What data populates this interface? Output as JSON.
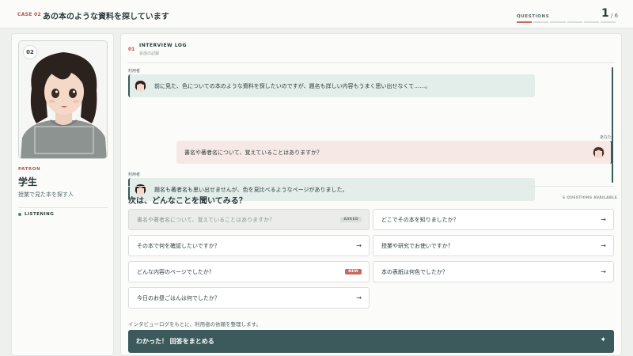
{
  "header": {
    "case_label": "CASE 02",
    "title": "あの本のような資料を探しています",
    "questions_label": "QUESTIONS",
    "current": "1",
    "total": "/ 6",
    "progress_segments": 6,
    "progress_done": 1
  },
  "patron": {
    "number": "02",
    "label": "PATRON",
    "name": "学生",
    "description": "授業で見た本を探す人",
    "status": "LISTENING"
  },
  "log": {
    "number": "01",
    "title": "INTERVIEW LOG",
    "subtitle": "会話の記録",
    "messages": [
      {
        "role": "patron",
        "speaker": "利用者",
        "text": "前に見た、色についての本のような資料を探したいのですが、題名も詳しい内容もうまく思い出せなくて……。"
      },
      {
        "role": "user",
        "speaker": "あなた",
        "text": "書名や著者名について、覚えていることはありますか？"
      },
      {
        "role": "patron",
        "speaker": "利用者",
        "text": "題名も著者名も思い出せませんが、色を見比べるようなページがありました。"
      }
    ]
  },
  "next": {
    "title": "次は、どんなことを聞いてみる？",
    "available": "6 QUESTIONS AVAILABLE",
    "questions": [
      {
        "text": "書名や著者名について、覚えていることはありますか？",
        "badge": "ASKED"
      },
      {
        "text": "どこでその本を知りましたか？",
        "arrow": "→"
      },
      {
        "text": "その本で何を確認したいですか？",
        "arrow": "→"
      },
      {
        "text": "授業や研究でお使いですか？",
        "arrow": "→"
      },
      {
        "text": "どんな内容のページでしたか？",
        "badge": "NEW"
      },
      {
        "text": "本の表紙は何色でしたか？",
        "arrow": "→"
      },
      {
        "text": "今日のお昼ごはんは何でしたか？",
        "arrow": "→"
      }
    ]
  },
  "footer": {
    "note": "インタビューログをもとに、利用者の依頼を整理します。",
    "submit_label": "わかった！ 回答をまとめる",
    "submit_icon": "✦"
  },
  "colors": {
    "accent": "#c8695f",
    "primary": "#3c5a5b",
    "patron_bubble": "#e3eeea",
    "user_bubble": "#f6e8e5"
  }
}
